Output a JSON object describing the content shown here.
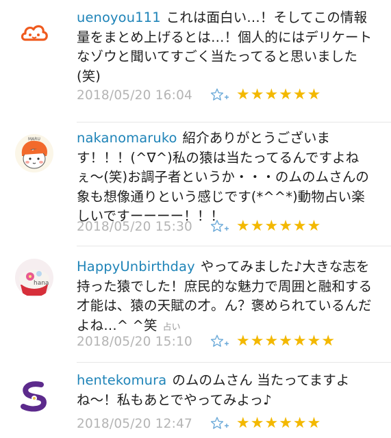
{
  "comments": [
    {
      "username": "uenoyou111",
      "text": "これは面白い…！そしてこの情報量をまとめ上げるとは…！個人的にはデリケートなゾウと聞いてすごく当たってると思いました(笑)",
      "tag": "",
      "date": "2018/05/20 16:04",
      "stars": "★★★★★★",
      "avatar_icon": "orange-smiling-cloud-icon"
    },
    {
      "username": "nakanomaruko",
      "text": "紹介ありがとうございます！！！(^∇^)私の猿は当たってるんですよねぇ〜(笑)お調子者というか・・・のムのムさんの象も想像通りという感じです(*^^*)動物占い楽しいですーーーー！！！",
      "tag": "",
      "date": "2018/05/20 15:30",
      "stars": "★★★★★★",
      "avatar_icon": "maru-cartoon-face-icon"
    },
    {
      "username": "HappyUnbirthday",
      "text": "やってみました♪大きな志を持った猿でした！庶民的な魅力で周囲と融和する才能は、猿の天賦の才。ん？褒められているんだよね…^ ^笑",
      "tag": "占い",
      "date": "2018/05/20 15:10",
      "stars": "★★★★★★★",
      "avatar_icon": "hana-cupcake-icon"
    },
    {
      "username": "hentekomura",
      "text": "のムのムさん 当たってますよね〜！私もあとでやってみよっ♪",
      "tag": "",
      "date": "2018/05/20 12:47",
      "stars": "★★★★★★",
      "avatar_icon": "purple-swirl-logo-icon"
    }
  ],
  "colors": {
    "username": "#1f84b8",
    "star": "#f3b800",
    "date": "#b4b4b4",
    "fav_outline": "#6aa9d8"
  }
}
